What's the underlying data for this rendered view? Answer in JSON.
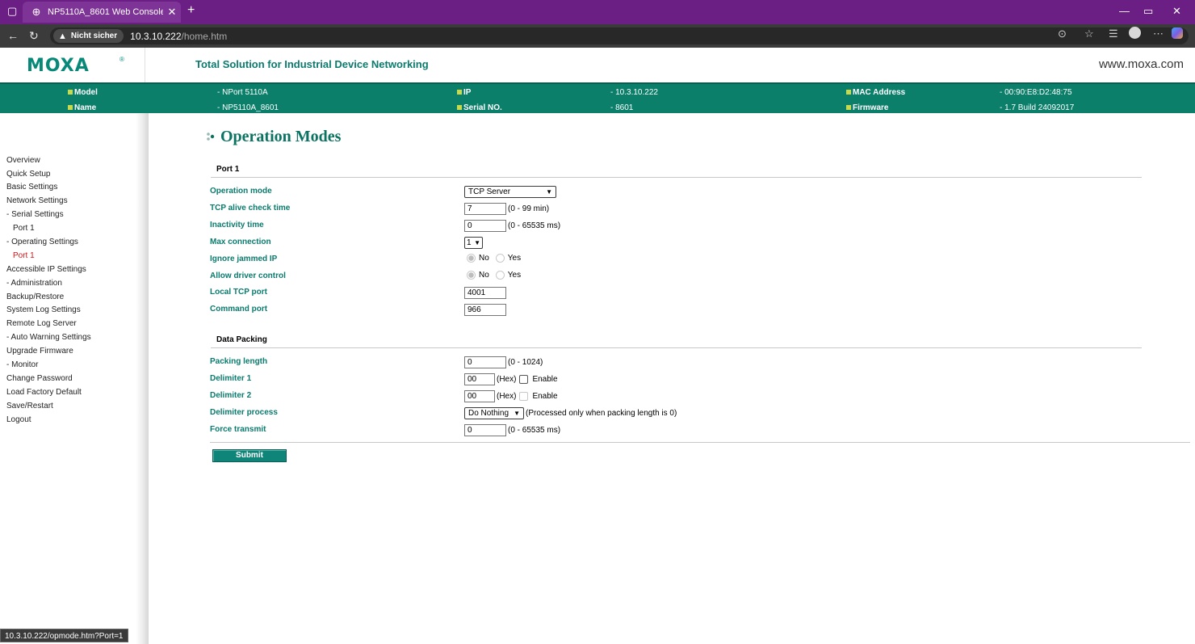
{
  "browser": {
    "tab_title": "NP5110A_8601 Web Console",
    "security_label": "Nicht sicher",
    "url_host": "10.3.10.222",
    "url_path": "/home.htm",
    "status_url": "10.3.10.222/opmode.htm?Port=1"
  },
  "header": {
    "logo": "MOXA",
    "logo_reg": "®",
    "tagline": "Total Solution for Industrial Device Networking",
    "site": "www.moxa.com"
  },
  "info": {
    "model_label": "Model",
    "model_value": "- NPort 5110A",
    "name_label": "Name",
    "name_value": "- NP5110A_8601",
    "ip_label": "IP",
    "ip_value": "- 10.3.10.222",
    "serial_label": "Serial NO.",
    "serial_value": "- 8601",
    "mac_label": "MAC Address",
    "mac_value": "- 00:90:E8:D2:48:75",
    "firmware_label": "Firmware",
    "firmware_value": "- 1.7 Build 24092017"
  },
  "sidebar": {
    "items": [
      {
        "label": "Overview"
      },
      {
        "label": "Quick Setup"
      },
      {
        "label": "Basic Settings"
      },
      {
        "label": "Network Settings"
      },
      {
        "label": "- Serial Settings"
      },
      {
        "label": "Port 1"
      },
      {
        "label": "- Operating Settings"
      },
      {
        "label": "Port 1"
      },
      {
        "label": "Accessible IP Settings"
      },
      {
        "label": "- Administration"
      },
      {
        "label": "Backup/Restore"
      },
      {
        "label": "System Log Settings"
      },
      {
        "label": "Remote Log Server"
      },
      {
        "label": "- Auto Warning Settings"
      },
      {
        "label": "Upgrade Firmware"
      },
      {
        "label": "- Monitor"
      },
      {
        "label": "Change Password"
      },
      {
        "label": "Load Factory Default"
      },
      {
        "label": "Save/Restart"
      },
      {
        "label": "Logout"
      }
    ]
  },
  "main": {
    "title": "Operation Modes",
    "port_section": "Port 1",
    "packing_section": "Data Packing",
    "submit_label": "Submit",
    "fields": {
      "op_mode": {
        "label": "Operation mode",
        "value": "TCP Server"
      },
      "alive": {
        "label": "TCP alive check time",
        "value": "7",
        "hint": "(0 - 99 min)"
      },
      "inactivity": {
        "label": "Inactivity time",
        "value": "0",
        "hint": "(0 - 65535 ms)"
      },
      "max_conn": {
        "label": "Max connection",
        "value": "1"
      },
      "ignore_jammed": {
        "label": "Ignore jammed IP",
        "opt_no": "No",
        "opt_yes": "Yes",
        "selected": "No"
      },
      "driver_control": {
        "label": "Allow driver control",
        "opt_no": "No",
        "opt_yes": "Yes",
        "selected": "No"
      },
      "local_tcp": {
        "label": "Local TCP port",
        "value": "4001"
      },
      "command_port": {
        "label": "Command port",
        "value": "966"
      },
      "packing_length": {
        "label": "Packing length",
        "value": "0",
        "hint": "(0 - 1024)"
      },
      "delimiter1": {
        "label": "Delimiter 1",
        "value": "00",
        "hex": "(Hex)",
        "enable": "Enable",
        "enabled": false
      },
      "delimiter2": {
        "label": "Delimiter 2",
        "value": "00",
        "hex": "(Hex)",
        "enable": "Enable",
        "enabled": false
      },
      "delimiter_process": {
        "label": "Delimiter process",
        "value": "Do Nothing",
        "hint": "(Processed only when packing length is 0)"
      },
      "force_transmit": {
        "label": "Force transmit",
        "value": "0",
        "hint": "(0 - 65535 ms)"
      }
    }
  },
  "colors": {
    "brand_teal": "#0c7f6b",
    "label_teal": "#0a7b6e",
    "active_red": "#d8151b",
    "title_bar_purple": "#6b1f84"
  }
}
